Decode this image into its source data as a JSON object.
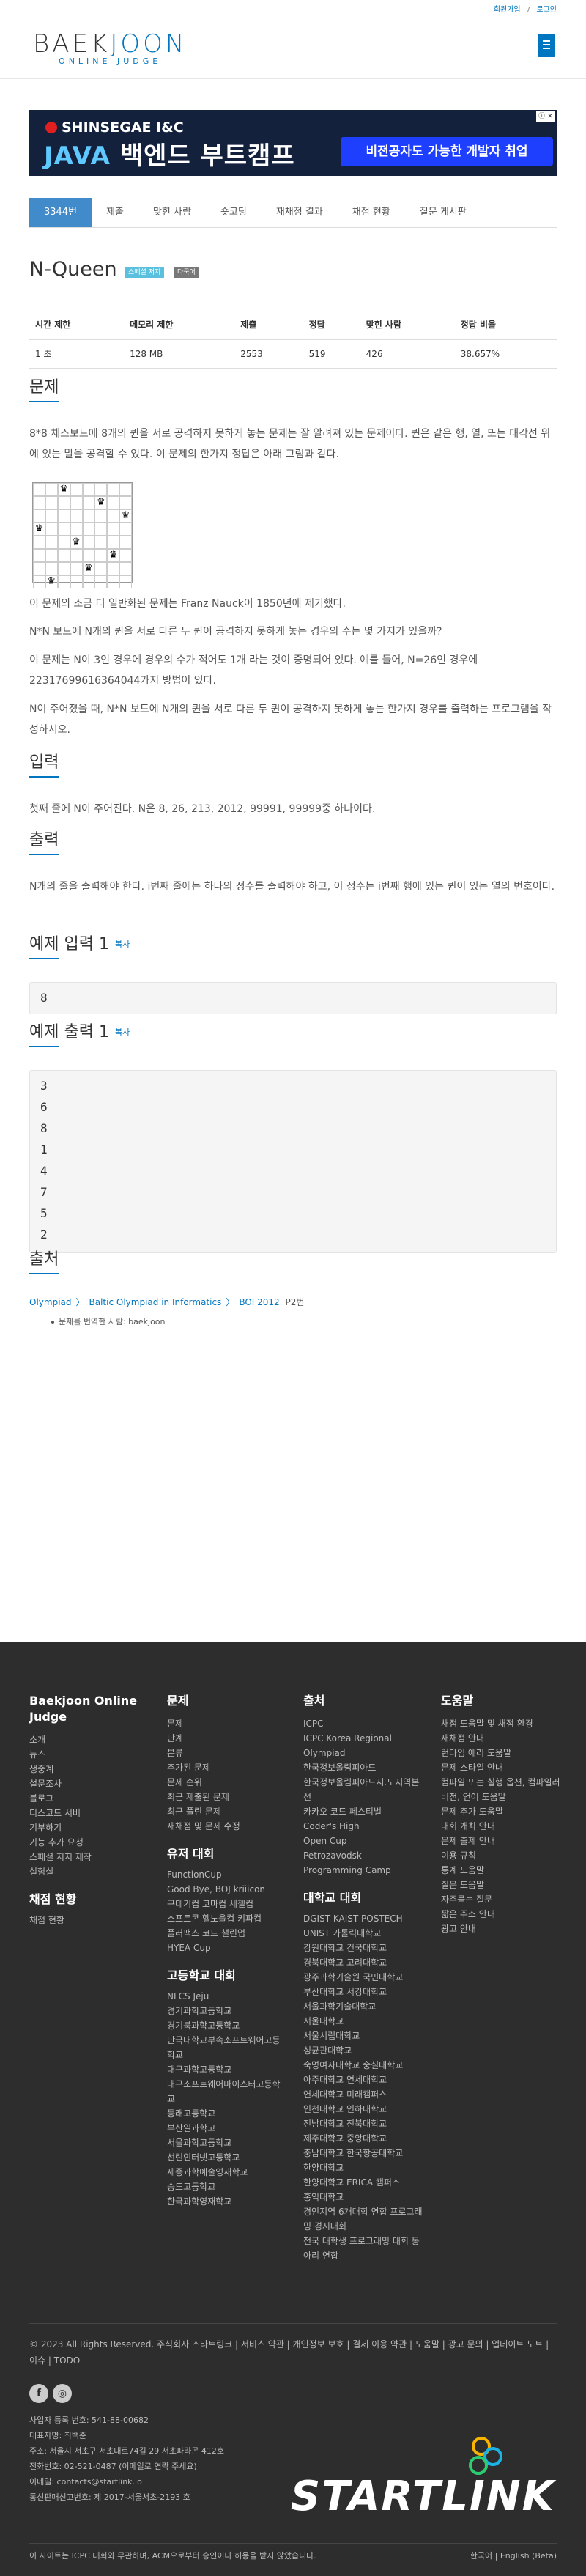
{
  "topbar": {
    "signup": "회원가입",
    "sep": "/",
    "login": "로그인"
  },
  "logo": {
    "name_a": "BAEK",
    "name_b": "JOON",
    "sub": "ONLINE JUDGE"
  },
  "ad": {
    "brand": "SHINSEGAE I&C",
    "title_a": "JAVA ",
    "title_b": "백엔드 부트캠프",
    "pill": "비전공자도 가능한 개발자 취업",
    "close": "ⓘ ✕"
  },
  "tabs": [
    "3344번",
    "제출",
    "맞힌 사람",
    "숏코딩",
    "재채점 결과",
    "채점 현황",
    "질문 게시판"
  ],
  "problem": {
    "title": "N-Queen",
    "labels": [
      "스페셜 저지",
      "다국어"
    ],
    "label_colors": [
      "#5bc0de",
      "#777777"
    ],
    "headers": [
      "시간 제한",
      "메모리 제한",
      "제출",
      "정답",
      "맞힌 사람",
      "정답 비율"
    ],
    "values": [
      "1 초",
      "128 MB",
      "2553",
      "519",
      "426",
      "38.657%"
    ]
  },
  "sections": {
    "desc_title": "문제",
    "desc_p1": "8*8 체스보드에 8개의 퀸을 서로 공격하지 못하게 놓는 문제는 잘 알려져 있는 문제이다. 퀸은 같은 행, 열, 또는 대각선 위에 있는 말을 공격할 수 있다. 이 문제의 한가지 정답은 아래 그림과 같다.",
    "desc_p2": "이 문제의 조금 더 일반화된 문제는 Franz Nauck이 1850년에 제기했다.",
    "desc_p3": "N*N 보드에 N개의 퀸을 서로 다른 두 퀸이 공격하지 못하게 놓는 경우의 수는 몇 가지가 있을까?",
    "desc_p4": "이 문제는 N이 3인 경우에 경우의 수가 적어도 1개 라는 것이 증명되어 있다. 예를 들어, N=26인 경우에 22317699616364044가지 방법이 있다.",
    "desc_p5": "N이 주어졌을 때, N*N 보드에 N개의 퀸을 서로 다른 두 퀸이 공격하지 못하게 놓는 한가지 경우를 출력하는 프로그램을 작성하시오.",
    "input_title": "입력",
    "input_p": "첫째 줄에 N이 주어진다. N은 8, 26, 213, 2012, 99991, 99999중 하나이다.",
    "output_title": "출력",
    "output_p": "N개의 줄을 출력해야 한다. i번째 줄에는 하나의 정수를 출력해야 하고, 이 정수는 i번째 행에 있는 퀸이 있는 열의 번호이다.",
    "sample_in_title": "예제 입력 1",
    "sample_out_title": "예제 출력 1",
    "copy": "복사",
    "sample_in": "8",
    "sample_out": [
      "3",
      "6",
      "8",
      "1",
      "4",
      "7",
      "5",
      "2"
    ],
    "source_title": "출처"
  },
  "board_queens": [
    3,
    6,
    8,
    1,
    4,
    7,
    5,
    2
  ],
  "queen_glyph": "♛",
  "source": {
    "a": "Olympiad",
    "b": "Baltic Olympiad in Informatics",
    "c": "BOI 2012",
    "d": "P2번",
    "bullet": "문제를 번역한 사람: baekjoon",
    "sep": "〉"
  },
  "footer": {
    "col1": {
      "title": "Baekjoon Online Judge",
      "items": [
        "소개",
        "뉴스",
        "생중계",
        "설문조사",
        "블로그",
        "디스코드 서버",
        "기부하기",
        "기능 추가 요청",
        "스페셜 저지 제작",
        "실험실"
      ],
      "title2": "채점 현황",
      "items2": [
        "채점 현황"
      ]
    },
    "col2": {
      "title": "문제",
      "items": [
        "문제",
        "단계",
        "분류",
        "추가된 문제",
        "문제 순위",
        "최근 제출된 문제",
        "최근 풀린 문제",
        "재채점 및 문제 수정"
      ],
      "title2": "유저 대회",
      "items2": [
        "FunctionCup",
        "Good Bye, BOJ kriiicon",
        "구데기컵 코마컵 세젤컵",
        "소프트콘 헬노을컵 키파컵",
        "플러팩스 코드 챌린업",
        "HYEA Cup"
      ],
      "title3": "고등학교 대회",
      "items3": [
        "NLCS Jeju",
        "경기과학고등학교",
        "경기북과학고등학교",
        "단국대학교부속소프트웨어고등학교",
        "대구과학고등학교",
        "대구소프트웨어마이스터고등학교",
        "동래고등학교",
        "부산일과학고",
        "서울과학고등학교",
        "선린인터넷고등학교",
        "세종과학예술영재학교",
        "송도고등학교",
        "한국과학영재학교"
      ]
    },
    "col3": {
      "title": "출처",
      "items": [
        "ICPC",
        "ICPC Korea Regional",
        "Olympiad",
        "한국정보올림피아드",
        "한국정보올림피아드시.도지역본선",
        "카카오 코드 페스티벌",
        "Coder's High",
        "Open Cup",
        "Petrozavodsk",
        "Programming Camp"
      ],
      "title2": "대학교 대회",
      "items2": [
        "DGIST KAIST POSTECH UNIST 가톨릭대학교",
        "강원대학교 건국대학교",
        "경북대학교 고려대학교",
        "광주과학기술원 국민대학교",
        "부산대학교 서강대학교",
        "서울과학기술대학교",
        "서울대학교",
        "서울시립대학교",
        "성균관대학교",
        "숙명여자대학교 숭실대학교",
        "아주대학교 연세대학교",
        "연세대학교 미래캠퍼스",
        "인천대학교 인하대학교",
        "전남대학교 전북대학교",
        "제주대학교 중앙대학교",
        "충남대학교 한국항공대학교",
        "한양대학교",
        "한양대학교 ERICA 캠퍼스",
        "홍익대학교",
        "경인지역 6개대학 연합 프로그래밍 경시대회",
        "전국 대학생 프로그래밍 대회 동아리 연합"
      ]
    },
    "col4": {
      "title": "도움말",
      "items": [
        "채점 도움말 및 채점 환경",
        "재채점 안내",
        "런타임 에러 도움말",
        "문제 스타일 안내",
        "컴파일 또는 실행 옵션, 컴파일러 버전, 언어 도움말",
        "문제 추가 도움말",
        "대회 개최 안내",
        "문제 출제 안내",
        "이용 규칙",
        "통계 도움말",
        "질문 도움말",
        "자주묻는 질문",
        "짧은 주소 안내",
        "광고 안내"
      ]
    },
    "copyright": "© 2023 All Rights Reserved. 주식회사 스타트링크  |  서비스 약관  |  개인정보 보호  |  결제 이용 약관  |  도움말  |  광고 문의  |  업데이트 노트  |  이슈  |  TODO",
    "social": [
      "f",
      "◎"
    ],
    "biz": [
      "사업자 등록 번호: 541-88-00682",
      "대표자명: 최백준",
      "주소: 서울시 서초구 서초대로74길 29 서초파라곤 412호",
      "전화번호: 02-521-0487 (이메일로 연락 주세요)",
      "이메일: contacts@startlink.io",
      "통신판매신고번호: 제 2017-서울서초-2193 호"
    ],
    "startlink": "STARTLINK",
    "bottom": "이 사이트는 ICPC 대회와 무관하며, ACM으로부터 승인이나 허용을 받지 않았습니다.",
    "lang": "한국어  |  English (Beta)"
  }
}
